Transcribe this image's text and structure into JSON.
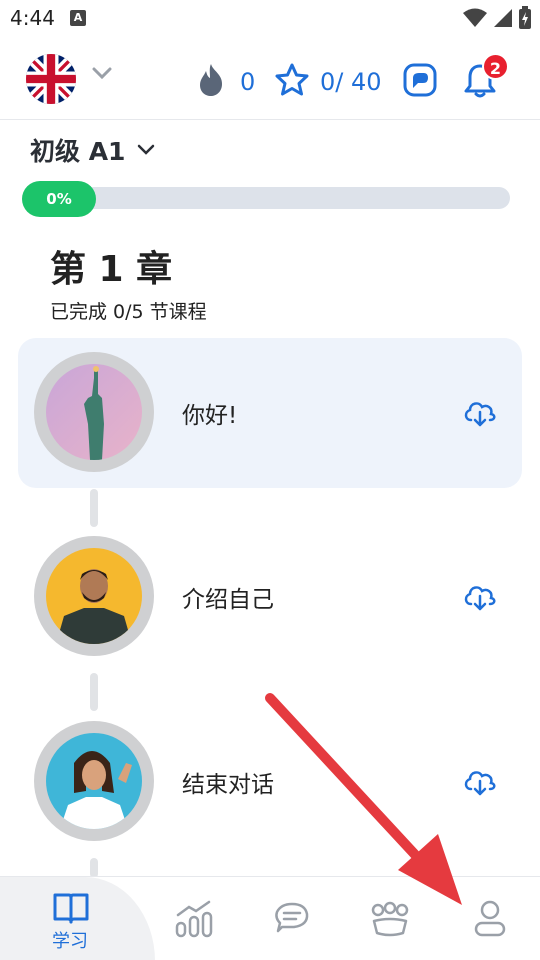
{
  "status_bar": {
    "time": "4:44",
    "notification_icon": "A"
  },
  "header": {
    "streak_count": "0",
    "stars": "0/ 40",
    "notification_count": "2",
    "colors": {
      "accent": "#1f6fd8",
      "badge": "#e8202f"
    }
  },
  "level": {
    "label": "初级 A1",
    "progress_percent": 0,
    "progress_label": "0%"
  },
  "chapter": {
    "title": "第 1 章",
    "subtitle": "已完成 0/5 节课程"
  },
  "lessons": [
    {
      "title": "你好!",
      "icon": "cloud-download-icon"
    },
    {
      "title": "介绍自己",
      "icon": "cloud-download-icon"
    },
    {
      "title": "结束对话",
      "icon": "cloud-download-icon"
    }
  ],
  "bottom_nav": {
    "items": [
      {
        "label": "学习",
        "icon": "book-icon",
        "active": true
      },
      {
        "label": "",
        "icon": "stats-icon"
      },
      {
        "label": "",
        "icon": "chat-icon"
      },
      {
        "label": "",
        "icon": "community-icon"
      },
      {
        "label": "",
        "icon": "profile-icon"
      }
    ]
  }
}
